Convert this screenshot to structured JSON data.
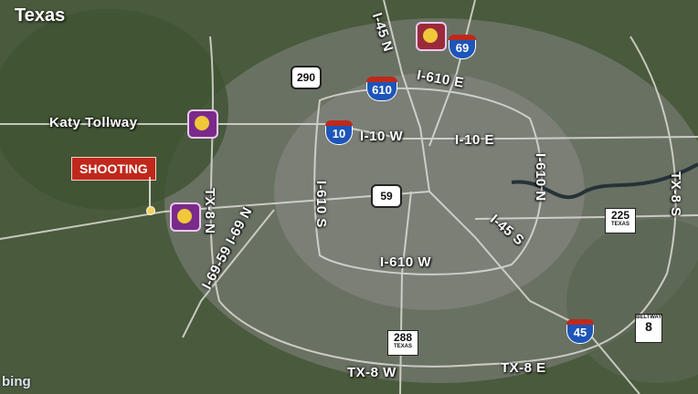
{
  "map_title": "Texas",
  "callout": "SHOOTING",
  "roads": {
    "katy": "Katy Tollway",
    "i45n": "I-45 N",
    "i610e": "I-610 E",
    "i10w": "I-10 W",
    "i10e": "I-10 E",
    "i610n": "I-610 N",
    "tx8s": "TX-8 S",
    "tx8n": "TX-8 N",
    "i69_59": "I-69-59 I-69 N",
    "i610s": "I-610 S",
    "i45s": "I-45 S",
    "i610w": "I-610 W",
    "tx8w": "TX-8 W",
    "tx8e": "TX-8 E"
  },
  "shields": {
    "i69": "69",
    "i610": "610",
    "i10": "10",
    "i45": "45",
    "us290": "290",
    "us59": "59",
    "tx225": "225",
    "tx225_sub": "TEXAS",
    "tx288": "288",
    "tx288_sub": "TEXAS",
    "beltway8": "8",
    "beltway8_sub": "BELTWAY"
  },
  "attribution": "bing",
  "colors": {
    "background": "#4a5a3c",
    "urban": "#7a7f78",
    "road": "#dcdcd6",
    "callout": "#c0281c",
    "interstate_blue": "#1d55b8",
    "station_badge": "#7a2a8a"
  },
  "icons": [
    "police-station-badge-icon",
    "incident-marker-icon"
  ]
}
